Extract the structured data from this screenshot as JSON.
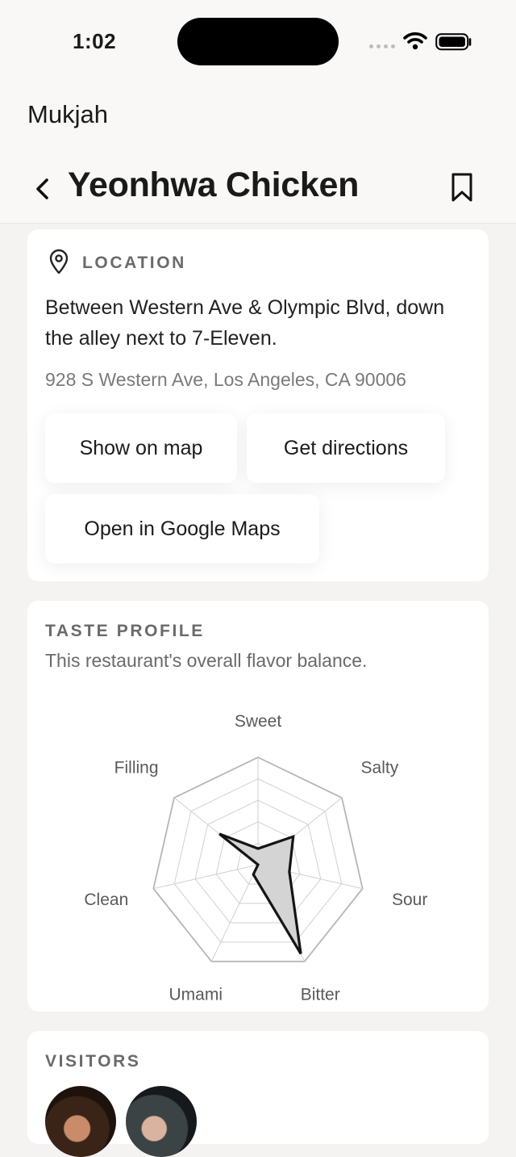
{
  "status_bar": {
    "time": "1:02"
  },
  "header": {
    "app_name": "Mukjah",
    "title": "Yeonhwa Chicken"
  },
  "location": {
    "heading": "LOCATION",
    "description": "Between Western Ave & Olympic Blvd, down the alley next to 7-Eleven.",
    "address": "928 S Western Ave, Los Angeles, CA 90006",
    "buttons": {
      "show_map": "Show on map",
      "directions": "Get directions",
      "google_maps": "Open in Google Maps"
    }
  },
  "taste_profile": {
    "heading": "TASTE PROFILE",
    "subtitle": "This restaurant's overall flavor balance."
  },
  "chart_data": {
    "type": "radar",
    "axes": [
      "Sweet",
      "Salty",
      "Sour",
      "Bitter",
      "Umami",
      "Clean",
      "Filling"
    ],
    "values": [
      0.15,
      0.42,
      0.3,
      0.92,
      0.1,
      0.0,
      0.46
    ],
    "max": 1,
    "grid_levels": 5,
    "colors": {
      "fill": "#d4d4d4",
      "stroke": "#151515",
      "grid": "#d0d0d0",
      "outer": "#b5b5b5"
    }
  },
  "visitors": {
    "heading": "VISITORS"
  }
}
